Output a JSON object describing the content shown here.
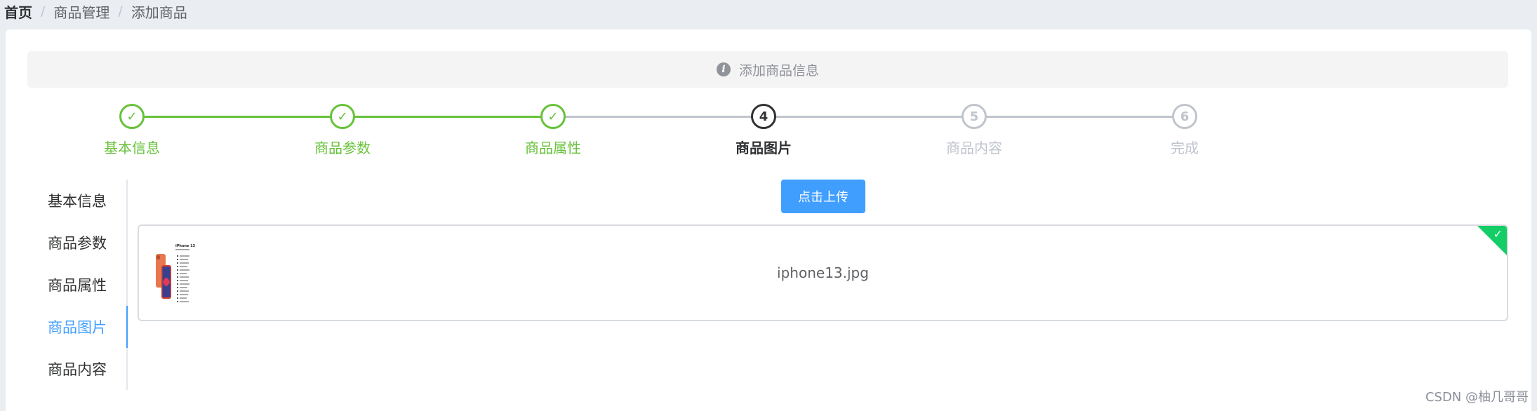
{
  "breadcrumb": {
    "home": "首页",
    "separator": "/",
    "level2": "商品管理",
    "level3": "添加商品"
  },
  "alert": {
    "text": "添加商品信息",
    "icon": "info-icon"
  },
  "steps": {
    "active_index": 3,
    "items": [
      {
        "label": "基本信息",
        "status": "finish",
        "marker": "✓"
      },
      {
        "label": "商品参数",
        "status": "finish",
        "marker": "✓"
      },
      {
        "label": "商品属性",
        "status": "finish",
        "marker": "✓"
      },
      {
        "label": "商品图片",
        "status": "process",
        "marker": "4"
      },
      {
        "label": "商品内容",
        "status": "wait",
        "marker": "5"
      },
      {
        "label": "完成",
        "status": "wait",
        "marker": "6"
      }
    ]
  },
  "tabs": {
    "active_index": 3,
    "items": [
      "基本信息",
      "商品参数",
      "商品属性",
      "商品图片",
      "商品内容"
    ]
  },
  "upload": {
    "button_label": "点击上传",
    "files": [
      {
        "name": "iphone13.jpg",
        "status": "success",
        "thumb_title": "iPhone 13"
      }
    ]
  },
  "colors": {
    "primary": "#409eff",
    "success": "#67c23a",
    "upload_success": "#13ce66",
    "wait": "#c0c4cc"
  },
  "watermark": "CSDN @柚几哥哥"
}
